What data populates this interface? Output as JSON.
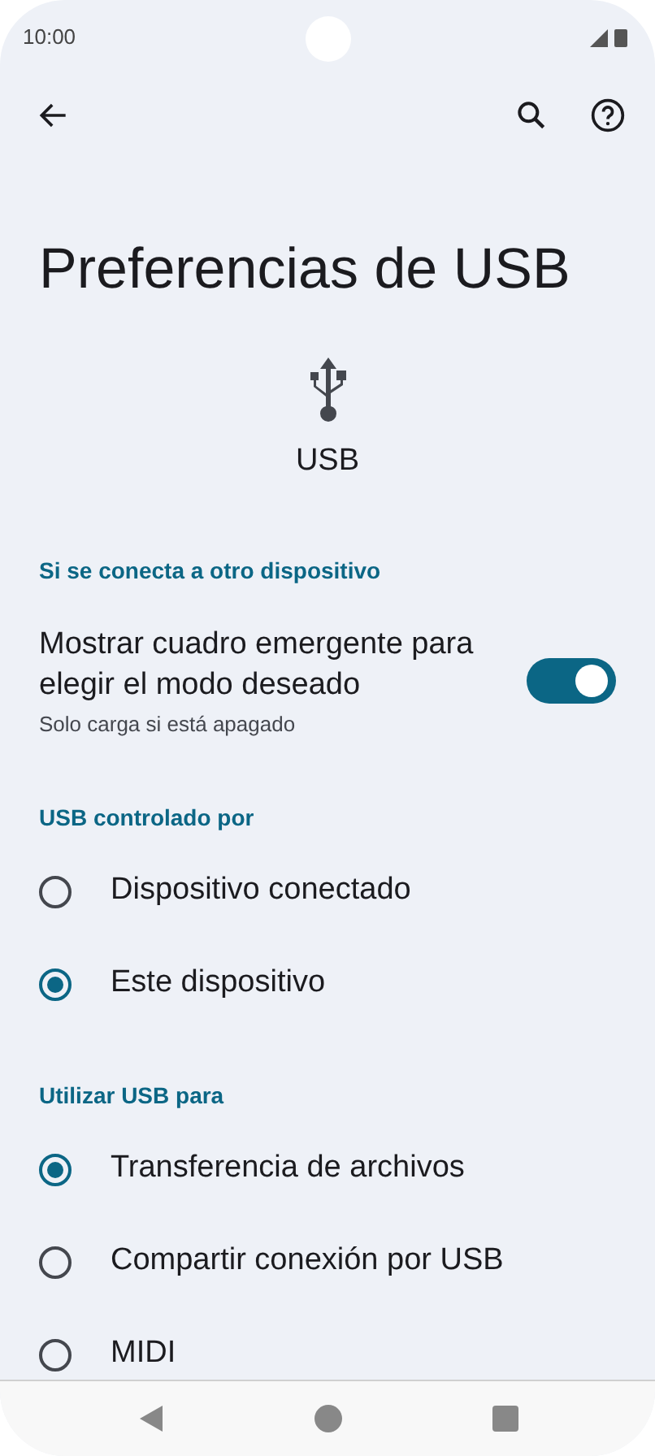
{
  "status_bar": {
    "time": "10:00"
  },
  "title": "Preferencias de USB",
  "header_label": "USB",
  "sections": [
    {
      "title": "Si se conecta a otro dispositivo",
      "items": [
        {
          "kind": "toggle",
          "label": "Mostrar cuadro emergente para elegir el modo deseado",
          "summary": "Solo carga si está apagado",
          "on": true
        }
      ]
    },
    {
      "title": "USB controlado por",
      "items": [
        {
          "kind": "radio",
          "label": "Dispositivo conectado",
          "selected": false
        },
        {
          "kind": "radio",
          "label": "Este dispositivo",
          "selected": true
        }
      ]
    },
    {
      "title": "Utilizar USB para",
      "items": [
        {
          "kind": "radio",
          "label": "Transferencia de archivos",
          "selected": true
        },
        {
          "kind": "radio",
          "label": "Compartir conexión por USB",
          "selected": false
        },
        {
          "kind": "radio",
          "label": "MIDI",
          "selected": false
        }
      ]
    }
  ]
}
